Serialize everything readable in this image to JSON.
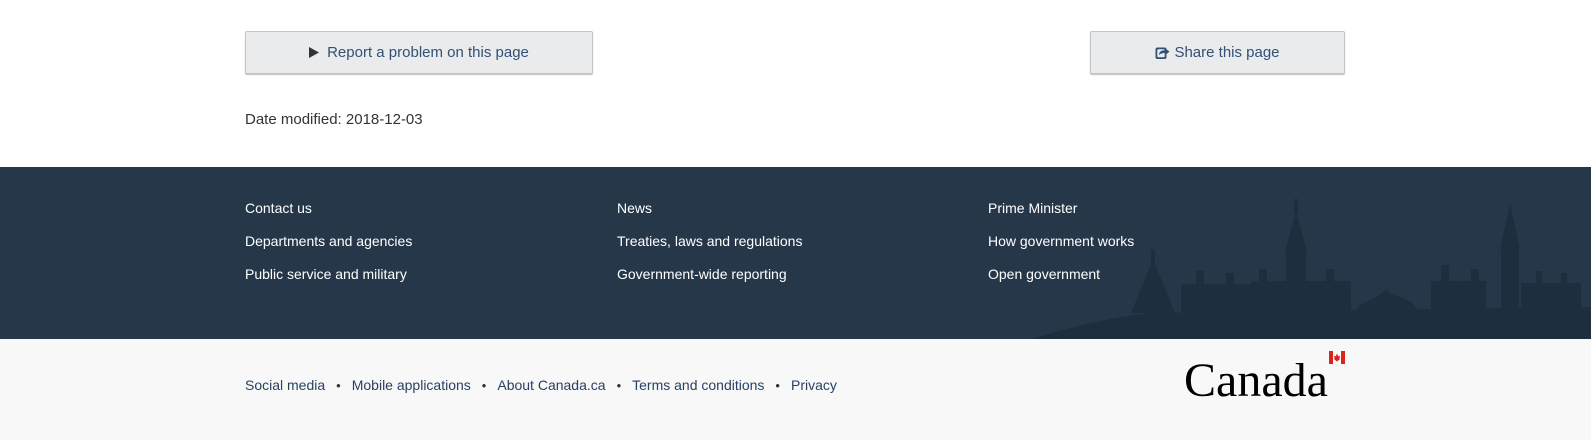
{
  "report_button": {
    "label": "Report a problem on this page",
    "icon": "play-triangle-icon"
  },
  "share_button": {
    "label": "Share this page",
    "icon": "share-icon"
  },
  "date_modified": {
    "label": "Date modified:",
    "value": "2018-12-03"
  },
  "footer_main": {
    "background": "#26374a",
    "columns": [
      {
        "links": [
          "Contact us",
          "Departments and agencies",
          "Public service and military"
        ]
      },
      {
        "links": [
          "News",
          "Treaties, laws and regulations",
          "Government-wide reporting"
        ]
      },
      {
        "links": [
          "Prime Minister",
          "How government works",
          "Open government"
        ]
      }
    ]
  },
  "footer_sub": {
    "background": "#f8f8f8",
    "links": [
      "Social media",
      "Mobile applications",
      "About Canada.ca",
      "Terms and conditions",
      "Privacy"
    ],
    "separator": "•",
    "wordmark": "Canada",
    "flag_color": "#d9251d"
  },
  "colors": {
    "button_text": "#335075",
    "button_bg": "#eaebed",
    "link_dark": "#284162"
  }
}
